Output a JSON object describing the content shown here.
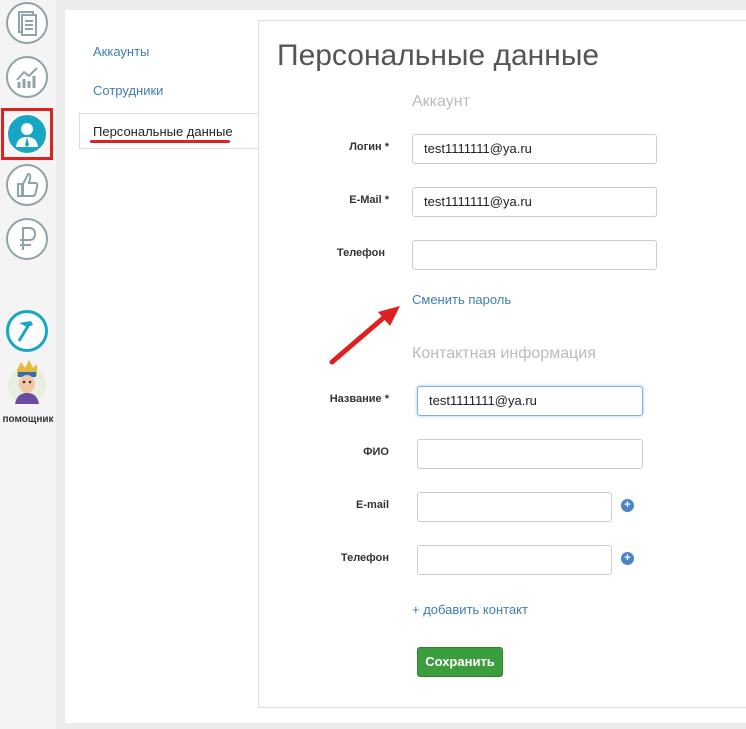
{
  "sidebar": {
    "icons": [
      "documents-icon",
      "analytics-icon",
      "user-icon",
      "thumbs-up-icon",
      "ruble-icon",
      "hammer-icon",
      "helper-avatar-icon"
    ],
    "helper_label": "помощник",
    "accent_color": "#17a7c4",
    "highlight_color": "#dd2222"
  },
  "subnav": {
    "items": [
      {
        "label": "Аккаунты"
      },
      {
        "label": "Сотрудники"
      },
      {
        "label": "Персональные данные"
      }
    ],
    "active_index": 2
  },
  "main": {
    "title": "Персональные данные",
    "account_section": {
      "title": "Аккаунт",
      "login_label": "Логин",
      "login_value": "test1111111@ya.ru",
      "email_label": "E-Mail",
      "email_value": "test1111111@ya.ru",
      "phone_label": "Телефон",
      "phone_value": "",
      "change_password_link": "Сменить пароль"
    },
    "contact_section": {
      "title": "Контактная информация",
      "name_label": "Название",
      "name_value": "test1111111@ya.ru",
      "fio_label": "ФИО",
      "fio_value": "",
      "email_label": "E-mail",
      "email_value": "",
      "phone_label": "Телефон",
      "phone_value": "",
      "add_contact_link": "+ добавить контакт"
    },
    "required_mark": "*",
    "save_button": "Сохранить"
  }
}
